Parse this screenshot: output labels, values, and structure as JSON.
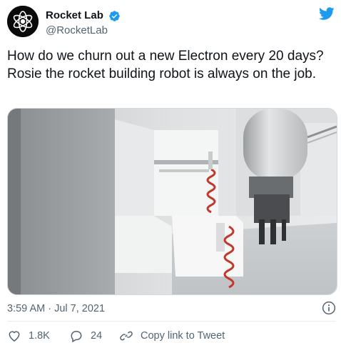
{
  "author": {
    "display_name": "Rocket Lab",
    "handle": "@RocketLab",
    "verified": true,
    "avatar_icon": "rocket-lab-logo-icon"
  },
  "brand_icon": "twitter-bird-icon",
  "tweet": {
    "text": "How do we churn out a new Electron every 20 days? Rosie the rocket building robot is always on the job.",
    "media": "video-still-robot-arm",
    "timestamp": "3:59 AM · Jul 7, 2021"
  },
  "actions": {
    "likes": "1.8K",
    "replies": "24",
    "copy_link_label": "Copy link to Tweet"
  },
  "colors": {
    "twitter_blue": "#1d9bf0",
    "secondary_text": "#536471",
    "border": "#cfd9de"
  }
}
